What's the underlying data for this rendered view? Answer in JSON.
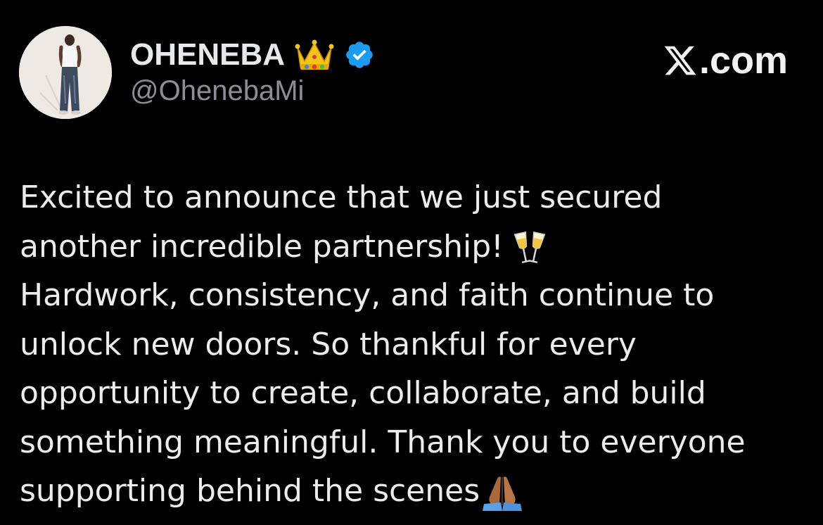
{
  "author": {
    "display_name": "OHENEBA",
    "handle": "@OhenebaMi",
    "avatar_icon": "profile-photo",
    "name_emoji": "crown-icon",
    "verified_badge_color": "#1d9bf0"
  },
  "brand": {
    "text": ".com",
    "logo": "x-logo-icon"
  },
  "tweet": {
    "lines": [
      "Excited to announce that we just secured",
      "another incredible partnership!",
      "Hardwork, consistency, and faith continue to",
      "unlock new doors. So thankful for every",
      "opportunity to create, collaborate, and build",
      "something meaningful. Thank you to everyone",
      "supporting behind the scenes"
    ],
    "emojis": {
      "line_2": "clinking-glasses-icon",
      "line_7": "folded-hands-icon"
    }
  },
  "colors": {
    "background": "#000000",
    "text_primary": "#e7e9ea",
    "text_secondary": "#8b8f94",
    "verified": "#1d9bf0"
  }
}
